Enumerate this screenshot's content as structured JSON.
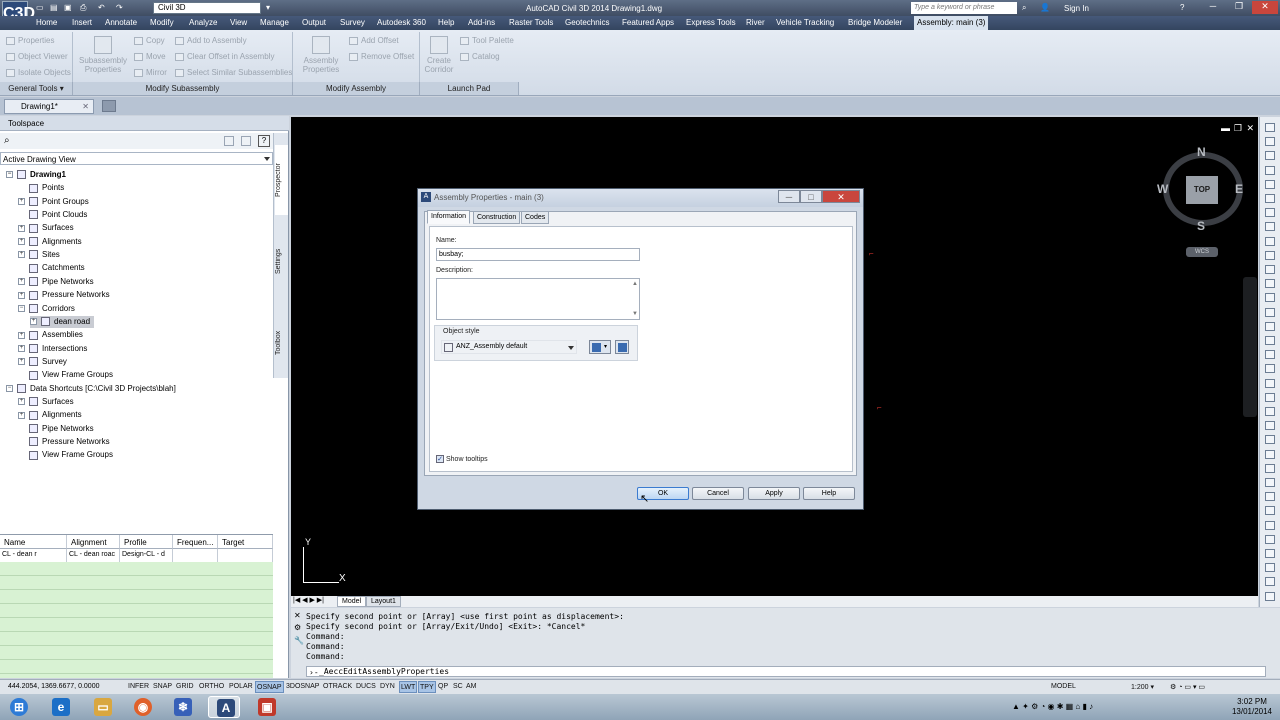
{
  "titlebar": {
    "app_logo": "C3D",
    "workspace": "Civil 3D",
    "title": "AutoCAD Civil 3D 2014    Drawing1.dwg",
    "search_placeholder": "Type a keyword or phrase",
    "sign_in": "Sign In"
  },
  "menu": [
    "Home",
    "Insert",
    "Annotate",
    "Modify",
    "Analyze",
    "View",
    "Manage",
    "Output",
    "Survey",
    "Autodesk 360",
    "Help",
    "Add-ins",
    "Raster Tools",
    "Geotechnics",
    "Featured Apps",
    "Express Tools",
    "River",
    "Vehicle Tracking",
    "Bridge Modeler",
    "Assembly: main (3)"
  ],
  "ribbon": {
    "general": {
      "items": [
        "Properties",
        "Object Viewer",
        "Isolate Objects"
      ],
      "title": "General Tools"
    },
    "subassembly": {
      "big": "Subassembly Properties",
      "items": [
        "Copy",
        "Move",
        "Mirror",
        "Add to Assembly",
        "Clear Offset in Assembly",
        "Select Similar Subassemblies"
      ],
      "title": "Modify Subassembly"
    },
    "assembly": {
      "big": "Assembly Properties",
      "items": [
        "Add Offset",
        "Remove Offset"
      ],
      "title": "Modify Assembly"
    },
    "launch": {
      "big": "Create Corridor",
      "items": [
        "Tool Palette",
        "Catalog"
      ],
      "title": "Launch Pad"
    }
  },
  "doc_tab": "Drawing1*",
  "toolspace": {
    "title": "Toolspace",
    "view": "Active Drawing View",
    "side_tabs": [
      "Prospector",
      "Settings",
      "Toolbox"
    ],
    "tree": [
      {
        "label": "Drawing1",
        "level": 0,
        "exp": "−",
        "bold": true
      },
      {
        "label": "Points",
        "level": 1,
        "exp": ""
      },
      {
        "label": "Point Groups",
        "level": 1,
        "exp": "+"
      },
      {
        "label": "Point Clouds",
        "level": 1,
        "exp": ""
      },
      {
        "label": "Surfaces",
        "level": 1,
        "exp": "+"
      },
      {
        "label": "Alignments",
        "level": 1,
        "exp": "+"
      },
      {
        "label": "Sites",
        "level": 1,
        "exp": "+"
      },
      {
        "label": "Catchments",
        "level": 1,
        "exp": ""
      },
      {
        "label": "Pipe Networks",
        "level": 1,
        "exp": "+"
      },
      {
        "label": "Pressure Networks",
        "level": 1,
        "exp": "+"
      },
      {
        "label": "Corridors",
        "level": 1,
        "exp": "−"
      },
      {
        "label": "dean road",
        "level": 2,
        "exp": "+",
        "sel": true
      },
      {
        "label": "Assemblies",
        "level": 1,
        "exp": "+"
      },
      {
        "label": "Intersections",
        "level": 1,
        "exp": "+"
      },
      {
        "label": "Survey",
        "level": 1,
        "exp": "+"
      },
      {
        "label": "View Frame Groups",
        "level": 1,
        "exp": ""
      },
      {
        "label": "Data Shortcuts [C:\\Civil 3D Projects\\blah]",
        "level": 0,
        "exp": "−"
      },
      {
        "label": "Surfaces",
        "level": 1,
        "exp": "+"
      },
      {
        "label": "Alignments",
        "level": 1,
        "exp": "+"
      },
      {
        "label": "Pipe Networks",
        "level": 1,
        "exp": ""
      },
      {
        "label": "Pressure Networks",
        "level": 1,
        "exp": ""
      },
      {
        "label": "View Frame Groups",
        "level": 1,
        "exp": ""
      }
    ],
    "grid": {
      "headers": [
        "Name",
        "Alignment",
        "Profile",
        "Frequen...",
        "Target"
      ],
      "row": [
        "CL - dean r",
        "CL - dean roac",
        "Design-CL - d",
        "",
        ""
      ]
    }
  },
  "viewcube": {
    "n": "N",
    "s": "S",
    "e": "E",
    "w": "W",
    "top": "TOP",
    "wcs": "WCS"
  },
  "model_tabs": [
    "Model",
    "Layout1"
  ],
  "ucs": {
    "x": "X",
    "y": "Y"
  },
  "command": {
    "lines": [
      "Specify second point or [Array] <use first point as displacement>:",
      "Specify second point or [Array/Exit/Undo] <Exit>: *Cancel*",
      "Command:",
      "Command:",
      "Command:"
    ],
    "input": "_AeccEditAssemblyProperties"
  },
  "dialog": {
    "title": "Assembly Properties - main (3)",
    "tabs": [
      "Information",
      "Construction",
      "Codes"
    ],
    "name_label": "Name:",
    "name_value": "busbay;",
    "description_label": "Description:",
    "description_value": "",
    "object_style_label": "Object style",
    "object_style_value": "ANZ_Assembly default",
    "show_tooltips": "Show tooltips",
    "show_tooltips_checked": true,
    "buttons": {
      "ok": "OK",
      "cancel": "Cancel",
      "apply": "Apply",
      "help": "Help"
    }
  },
  "statusbar": {
    "coords": "444.2054, 1369.6677, 0.0000",
    "toggles": [
      "INFER",
      "SNAP",
      "GRID",
      "ORTHO",
      "POLAR",
      "OSNAP",
      "3DOSNAP",
      "OTRACK",
      "DUCS",
      "DYN",
      "LWT",
      "TPY",
      "QP",
      "SC",
      "AM"
    ],
    "on": [
      "OSNAP",
      "LWT",
      "TPY"
    ],
    "model": "MODEL",
    "scale": "1:200"
  },
  "taskbar": {
    "time": "3:02 PM",
    "date": "13/01/2014"
  },
  "colors": {
    "accent": "#3b7bd0",
    "drawing_bg": "#000000",
    "grid_green": "#d8f2d3"
  }
}
